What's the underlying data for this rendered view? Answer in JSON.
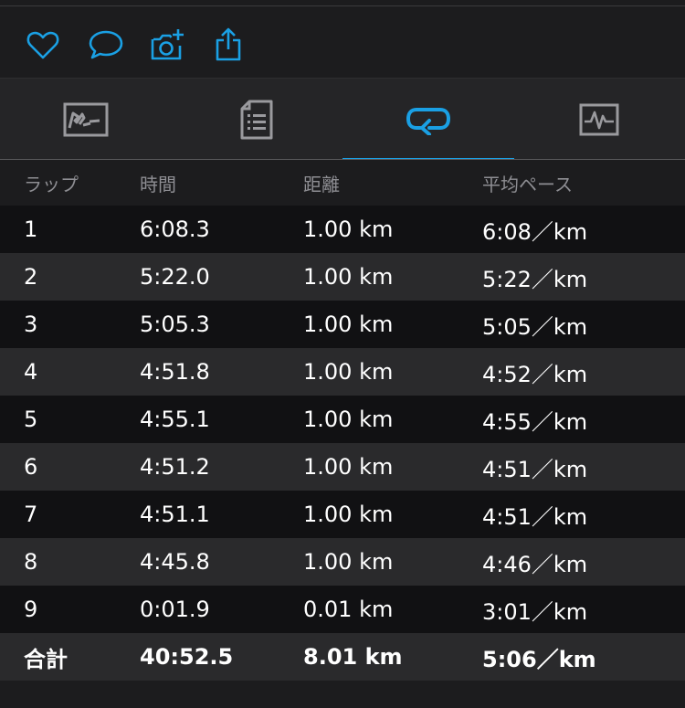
{
  "toolbar": {
    "icons": [
      "heart-icon",
      "comment-icon",
      "add-photo-icon",
      "share-icon"
    ],
    "accent": "#1aa0e4"
  },
  "tabs": [
    {
      "icon": "map-icon",
      "active": false
    },
    {
      "icon": "document-icon",
      "active": false
    },
    {
      "icon": "laps-icon",
      "active": true
    },
    {
      "icon": "chart-icon",
      "active": false
    }
  ],
  "table": {
    "headers": [
      "ラップ",
      "時間",
      "距離",
      "平均ペース"
    ],
    "rows": [
      [
        "1",
        "6:08.3",
        "1.00 km",
        "6:08／km"
      ],
      [
        "2",
        "5:22.0",
        "1.00 km",
        "5:22／km"
      ],
      [
        "3",
        "5:05.3",
        "1.00 km",
        "5:05／km"
      ],
      [
        "4",
        "4:51.8",
        "1.00 km",
        "4:52／km"
      ],
      [
        "5",
        "4:55.1",
        "1.00 km",
        "4:55／km"
      ],
      [
        "6",
        "4:51.2",
        "1.00 km",
        "4:51／km"
      ],
      [
        "7",
        "4:51.1",
        "1.00 km",
        "4:51／km"
      ],
      [
        "8",
        "4:45.8",
        "1.00 km",
        "4:46／km"
      ],
      [
        "9",
        "0:01.9",
        "0.01 km",
        "3:01／km"
      ]
    ],
    "total": [
      "合計",
      "40:52.5",
      "8.01 km",
      "5:06／km"
    ]
  }
}
